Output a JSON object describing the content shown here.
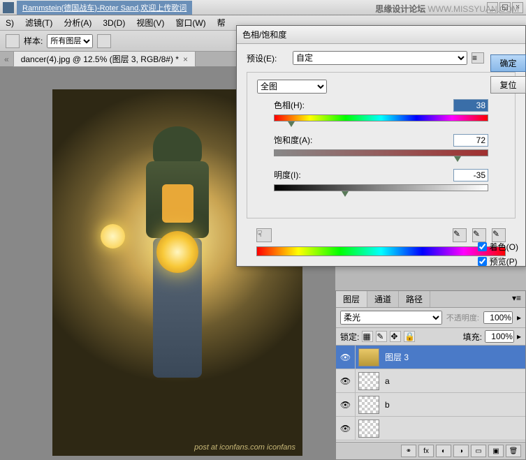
{
  "taskbar": {
    "title": "Rammstein(德国战车)-Roter Sand,欢迎上传歌词"
  },
  "watermark": {
    "text1": "思缘设计论坛",
    "text2": "WWW.MISSYUAN.COM"
  },
  "menu": {
    "filter": "滤镜(T)",
    "analysis": "分析(A)",
    "threed": "3D(D)",
    "view": "视图(V)",
    "window": "窗口(W)",
    "help": "帮"
  },
  "optbar": {
    "sample_label": "样本:",
    "sample_value": "所有图层"
  },
  "doctab": {
    "label": "dancer(4).jpg @ 12.5% (图层 3, RGB/8#) *"
  },
  "canvas": {
    "credit": "post at iconfans.com  iconfans"
  },
  "dialog": {
    "title": "色相/饱和度",
    "preset_label": "预设(E):",
    "preset_value": "自定",
    "range_value": "全图",
    "hue_label": "色相(H):",
    "hue_value": "38",
    "sat_label": "饱和度(A):",
    "sat_value": "72",
    "lig_label": "明度(I):",
    "lig_value": "-35",
    "ok": "确定",
    "reset": "复位",
    "colorize": "着色(O)",
    "preview": "预览(P)"
  },
  "layers": {
    "tab_layers": "图层",
    "tab_channels": "通道",
    "tab_paths": "路径",
    "blend": "柔光",
    "opacity_label": "不透明度:",
    "opacity_value": "100%",
    "lock_label": "锁定:",
    "fill_label": "填充:",
    "fill_value": "100%",
    "rows": [
      {
        "name": "图层 3",
        "selected": true,
        "gold": true
      },
      {
        "name": "a",
        "selected": false,
        "gold": false
      },
      {
        "name": "b",
        "selected": false,
        "gold": false
      },
      {
        "name": "",
        "selected": false,
        "gold": false
      }
    ],
    "fx": "fx"
  }
}
